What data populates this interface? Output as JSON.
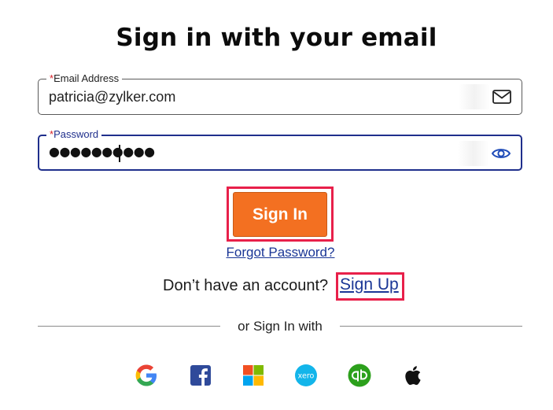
{
  "page": {
    "title": "Sign in with your email"
  },
  "email_field": {
    "required_mark": "*",
    "label": "Email Address",
    "value": "patricia@zylker.com",
    "icon": "mail-icon"
  },
  "password_field": {
    "required_mark": "*",
    "label": "Password",
    "value_masked": "●●●●●●●●●●",
    "icon": "eye-icon"
  },
  "actions": {
    "signin_label": "Sign In",
    "forgot_label": "Forgot Password?",
    "no_account_text": "Don’t have an account?",
    "signup_label": "Sign Up"
  },
  "divider": {
    "text": "or Sign In with"
  },
  "social_providers": [
    {
      "name": "google",
      "icon": "google-icon"
    },
    {
      "name": "facebook",
      "icon": "facebook-icon"
    },
    {
      "name": "microsoft",
      "icon": "microsoft-icon"
    },
    {
      "name": "xero",
      "icon": "xero-icon"
    },
    {
      "name": "quickbooks",
      "icon": "quickbooks-icon"
    },
    {
      "name": "apple",
      "icon": "apple-icon"
    }
  ],
  "colors": {
    "primary_button": "#f37021",
    "link": "#1a3696",
    "highlight": "#e8204a",
    "focus_border": "#1f2f8c"
  }
}
